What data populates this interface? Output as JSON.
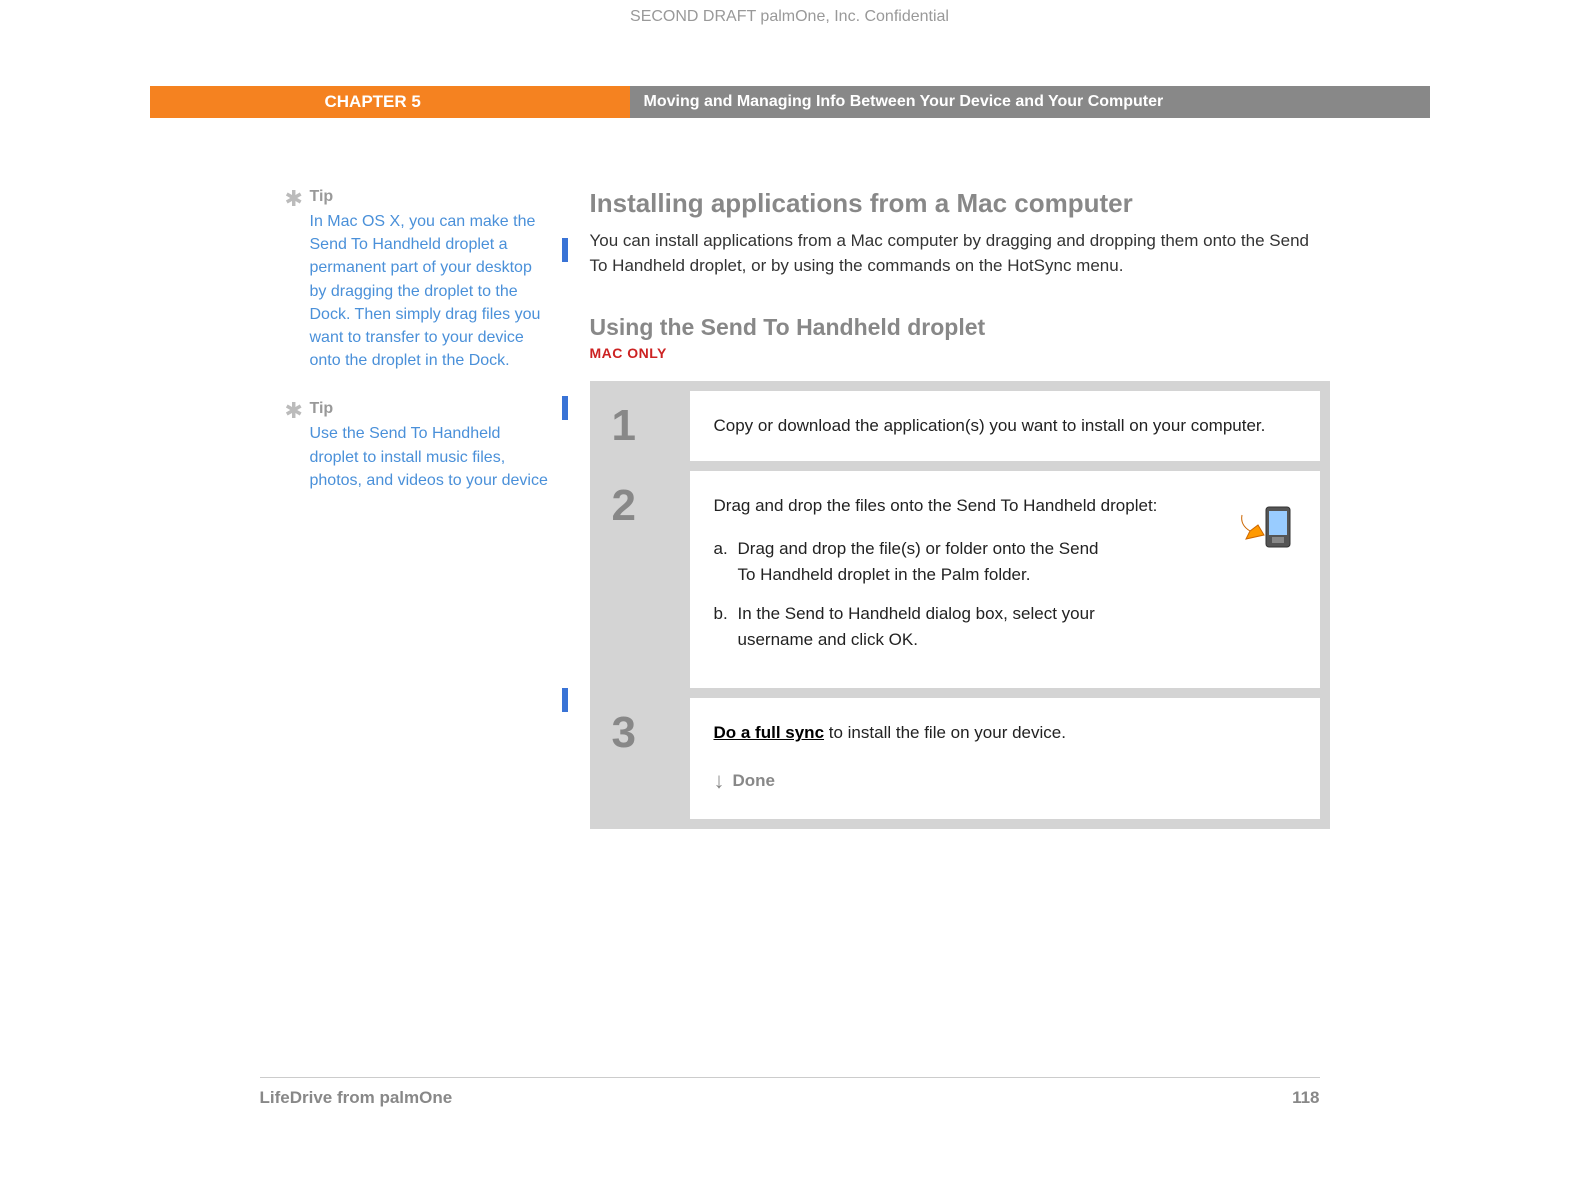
{
  "header": {
    "confidential": "SECOND DRAFT palmOne, Inc.  Confidential",
    "chapter": "CHAPTER 5",
    "chapter_title": "Moving and Managing Info Between Your Device and Your Computer"
  },
  "sidebar": {
    "tips": [
      {
        "label": "Tip",
        "text": "In Mac OS X, you can make the Send To Handheld droplet a permanent part of your desktop by dragging the droplet to the Dock. Then simply drag files you want to transfer to your device onto the droplet in the Dock."
      },
      {
        "label": "Tip",
        "text": "Use the Send To Handheld droplet to install music files, photos, and videos to your device"
      }
    ]
  },
  "main": {
    "section_title": "Installing applications from a Mac computer",
    "section_desc": "You can install applications from a Mac computer by dragging and dropping them onto the Send To Handheld droplet, or by using the commands on the HotSync menu.",
    "sub_title": "Using the Send To Handheld droplet",
    "badge": "MAC ONLY",
    "steps": [
      {
        "num": "1",
        "text": "Copy or download the application(s) you want to install on your computer."
      },
      {
        "num": "2",
        "intro": "Drag and drop the files onto the Send To Handheld droplet:",
        "substeps": [
          {
            "letter": "a.",
            "text": "Drag and drop the file(s) or folder onto the Send To Handheld droplet in the Palm folder."
          },
          {
            "letter": "b.",
            "text": "In the Send to Handheld dialog box, select your username and click OK."
          }
        ]
      },
      {
        "num": "3",
        "link": "Do a full sync",
        "rest": " to install the file on your device.",
        "done": "Done"
      }
    ]
  },
  "footer": {
    "product": "LifeDrive from palmOne",
    "page": "118"
  }
}
